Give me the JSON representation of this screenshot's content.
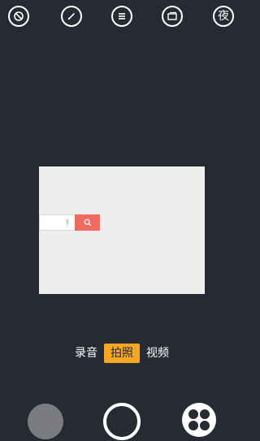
{
  "top_bar": {
    "buttons": [
      {
        "icon": "timer-off-icon"
      },
      {
        "icon": "speedometer-icon"
      },
      {
        "icon": "menu-icon"
      },
      {
        "icon": "aspect-ratio-icon"
      },
      {
        "icon": "night-mode-icon",
        "label": "夜"
      }
    ]
  },
  "preview": {
    "search_button_color": "#ef6a5f",
    "background_color": "#eeeeee"
  },
  "modes": {
    "items": [
      {
        "label": "录音",
        "active": false
      },
      {
        "label": "拍照",
        "active": true
      },
      {
        "label": "视频",
        "active": false
      }
    ],
    "active_color": "#f5a623"
  },
  "bottom_bar": {
    "gallery_icon": "gallery-thumbnail",
    "shutter_icon": "shutter-button",
    "effects_icon": "effects-grid-icon"
  },
  "colors": {
    "background": "#262a33"
  }
}
